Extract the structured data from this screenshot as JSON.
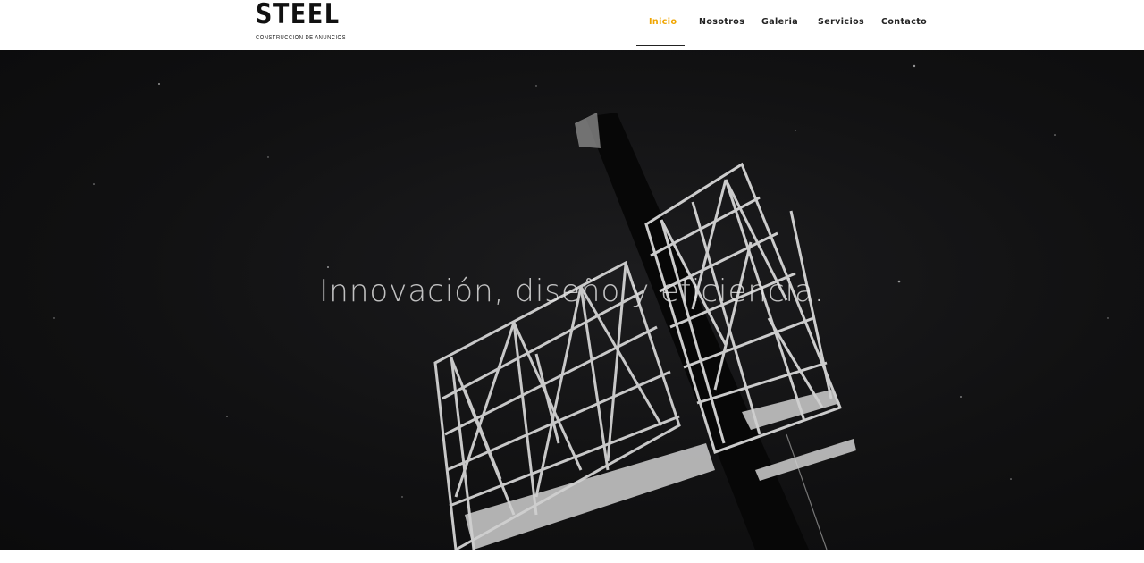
{
  "brand": {
    "name": "STEEL",
    "tagline": "CONSTRUCCION DE ANUNCIOS"
  },
  "nav": {
    "items": [
      {
        "label": "Inicio",
        "active": true
      },
      {
        "label": "Nosotros",
        "active": false
      },
      {
        "label": "Galeria",
        "active": false
      },
      {
        "label": "Servicios",
        "active": false
      },
      {
        "label": "Contacto",
        "active": false
      }
    ],
    "active_color": "#f0a500"
  },
  "hero": {
    "headline": "Innovación, diseño y eficiencia.",
    "image": "billboard-structure-night"
  }
}
